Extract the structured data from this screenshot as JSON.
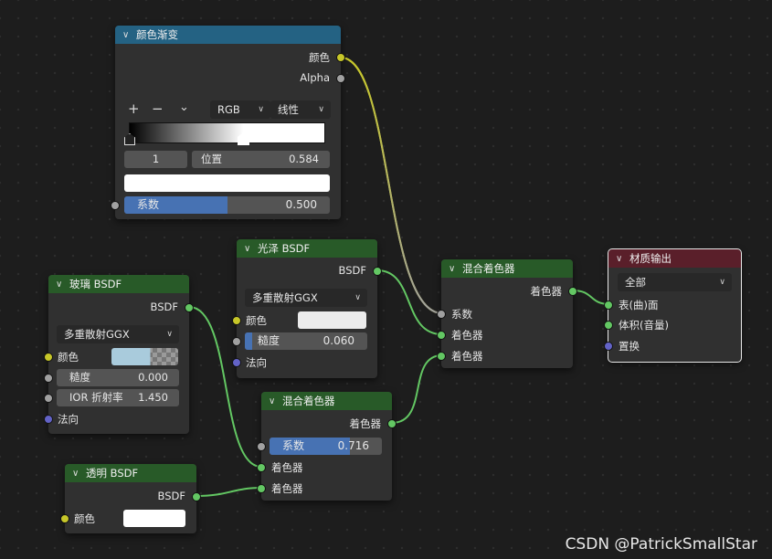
{
  "nodes": {
    "color_ramp": {
      "title": "颜色渐变",
      "out_color": "颜色",
      "out_alpha": "Alpha",
      "color_mode": "RGB",
      "interpolation": "线性",
      "stop_index": "1",
      "position_label": "位置",
      "position_value": "0.584",
      "factor_label": "系数",
      "factor_value": "0.500",
      "factor_fraction": 0.5,
      "tool_add": "+",
      "tool_remove": "−",
      "tool_menu": "⌄"
    },
    "glossy": {
      "title": "光泽 BSDF",
      "out": "BSDF",
      "distribution": "多重散射GGX",
      "color_label": "颜色",
      "roughness_label": "糙度",
      "roughness_value": "0.060",
      "roughness_fraction": 0.06,
      "normal_label": "法向"
    },
    "glass": {
      "title": "玻璃 BSDF",
      "out": "BSDF",
      "distribution": "多重散射GGX",
      "color_label": "颜色",
      "roughness_label": "糙度",
      "roughness_value": "0.000",
      "ior_label": "IOR 折射率",
      "ior_value": "1.450",
      "normal_label": "法向"
    },
    "mix_top": {
      "title": "混合着色器",
      "out": "着色器",
      "fac_label": "系数",
      "shader1": "着色器",
      "shader2": "着色器"
    },
    "mix_bottom": {
      "title": "混合着色器",
      "out": "着色器",
      "fac_label": "系数",
      "fac_value": "0.716",
      "fac_fraction": 0.716,
      "shader1": "着色器",
      "shader2": "着色器"
    },
    "transparent": {
      "title": "透明 BSDF",
      "out": "BSDF",
      "color_label": "颜色"
    },
    "material_output": {
      "title": "材质输出",
      "target": "全部",
      "surface": "表(曲)面",
      "volume": "体积(音量)",
      "displacement": "置换"
    }
  },
  "colors": {
    "color_socket": "#c7c729",
    "float_socket": "#a1a1a1",
    "shader_socket": "#63c763",
    "vector_socket": "#6363c7",
    "glass_color": "#a9cbdc",
    "glossy_color": "#ececec",
    "transparent_color": "#ffffff",
    "slider_fill": "#4772b3"
  },
  "watermark": "CSDN @PatrickSmallStar"
}
